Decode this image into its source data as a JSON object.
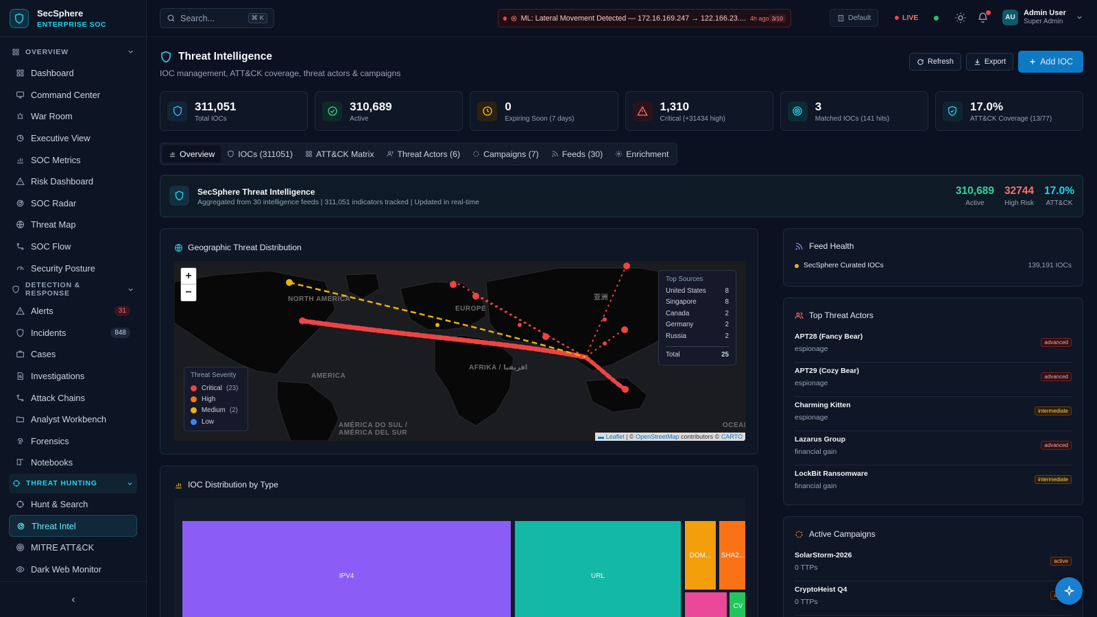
{
  "brand": {
    "name": "SecSphere",
    "subtitle": "ENTERPRISE SOC"
  },
  "sidebar": {
    "sections": [
      {
        "label": "OVERVIEW",
        "items": [
          {
            "label": "Dashboard",
            "icon": "grid-icon"
          },
          {
            "label": "Command Center",
            "icon": "monitor-icon"
          },
          {
            "label": "War Room",
            "icon": "siren-icon"
          },
          {
            "label": "Executive View",
            "icon": "pie-icon"
          },
          {
            "label": "SOC Metrics",
            "icon": "bar-chart-icon"
          },
          {
            "label": "Risk Dashboard",
            "icon": "warning-icon"
          },
          {
            "label": "SOC Radar",
            "icon": "radar-icon"
          },
          {
            "label": "Threat Map",
            "icon": "globe-icon"
          },
          {
            "label": "SOC Flow",
            "icon": "flow-icon"
          },
          {
            "label": "Security Posture",
            "icon": "gauge-icon"
          }
        ]
      },
      {
        "label": "DETECTION & RESPONSE",
        "items": [
          {
            "label": "Alerts",
            "icon": "warning-icon",
            "badge": "31"
          },
          {
            "label": "Incidents",
            "icon": "shield-icon",
            "badge": "848"
          },
          {
            "label": "Cases",
            "icon": "briefcase-icon"
          },
          {
            "label": "Investigations",
            "icon": "file-search-icon"
          },
          {
            "label": "Attack Chains",
            "icon": "flow-icon"
          },
          {
            "label": "Analyst Workbench",
            "icon": "folder-icon"
          },
          {
            "label": "Forensics",
            "icon": "fingerprint-icon"
          },
          {
            "label": "Notebooks",
            "icon": "book-icon"
          }
        ]
      },
      {
        "label": "THREAT HUNTING",
        "items": [
          {
            "label": "Hunt & Search",
            "icon": "crosshair-icon"
          },
          {
            "label": "Threat Intel",
            "icon": "radar-icon"
          },
          {
            "label": "MITRE ATT&CK",
            "icon": "target-icon"
          },
          {
            "label": "Dark Web Monitor",
            "icon": "eye-icon"
          }
        ]
      }
    ]
  },
  "topbar": {
    "search_placeholder": "Search...",
    "search_shortcut": "⌘ K",
    "alert_text": "ML: Lateral Movement Detected — 172.16.169.247 → 122.166.23....",
    "alert_ago": "4h ago",
    "alert_count": "3/10",
    "environment": "Default",
    "live_label": "LIVE",
    "user_initials": "AU",
    "user_name": "Admin User",
    "user_role": "Super Admin"
  },
  "page": {
    "title": "Threat Intelligence",
    "subtitle": "IOC management, ATT&CK coverage, threat actors & campaigns",
    "refresh_label": "Refresh",
    "export_label": "Export",
    "add_label": "Add IOC"
  },
  "stats": [
    {
      "value": "311,051",
      "label": "Total IOCs",
      "icon": "shield-icon",
      "color": "#38bdf8",
      "bg": "#102537"
    },
    {
      "value": "310,689",
      "label": "Active",
      "icon": "check-circle-icon",
      "color": "#34d399",
      "bg": "#0f2a25"
    },
    {
      "value": "0",
      "label": "Expiring Soon (7 days)",
      "icon": "clock-icon",
      "color": "#fbbf24",
      "bg": "#2a2210"
    },
    {
      "value": "1,310",
      "label": "Critical (+31434 high)",
      "icon": "warning-icon",
      "color": "#f87171",
      "bg": "#2a1318"
    },
    {
      "value": "3",
      "label": "Matched IOCs (141 hits)",
      "icon": "target-icon",
      "color": "#22d3ee",
      "bg": "#0f2a33"
    },
    {
      "value": "17.0%",
      "label": "ATT&CK Coverage (13/77)",
      "icon": "shield-check-icon",
      "color": "#22d3ee",
      "bg": "#112433"
    }
  ],
  "tabs": [
    {
      "label": "Overview",
      "icon": "bar-chart-icon",
      "active": true
    },
    {
      "label": "IOCs (311051)",
      "icon": "shield-icon"
    },
    {
      "label": "ATT&CK Matrix",
      "icon": "grid-icon"
    },
    {
      "label": "Threat Actors (6)",
      "icon": "users-icon"
    },
    {
      "label": "Campaigns (7)",
      "icon": "refresh-icon"
    },
    {
      "label": "Feeds (30)",
      "icon": "rss-icon"
    },
    {
      "label": "Enrichment",
      "icon": "gear-icon"
    }
  ],
  "banner": {
    "title": "SecSphere Threat Intelligence",
    "subtitle": "Aggregated from 30 intelligence feeds | 311,051 indicators tracked | Updated in real-time",
    "stats": [
      {
        "value": "310,689",
        "label": "Active",
        "color": "#34d399"
      },
      {
        "value": "32744",
        "label": "High Risk",
        "color": "#f87171"
      },
      {
        "value": "17.0%",
        "label": "ATT&CK",
        "color": "#22d3ee"
      }
    ]
  },
  "geo": {
    "title": "Geographic Threat Distribution",
    "map_labels": [
      "NORTH AMERICA",
      "EUROPE",
      "AFRIKA / افريقيا",
      "AMERICA",
      "AMÉRICA DO SUL / AMÉRICA DEL SUR",
      "亚洲",
      "OCEAN"
    ],
    "top_sources_title": "Top Sources",
    "top_sources": [
      {
        "name": "United States",
        "count": "8"
      },
      {
        "name": "Singapore",
        "count": "8"
      },
      {
        "name": "Canada",
        "count": "2"
      },
      {
        "name": "Germany",
        "count": "2"
      },
      {
        "name": "Russia",
        "count": "2"
      }
    ],
    "total_label": "Total",
    "total_value": "25",
    "legend_title": "Threat Severity",
    "legend": [
      {
        "label": "Critical",
        "count": "(23)",
        "color": "#ef4444"
      },
      {
        "label": "High",
        "count": "",
        "color": "#f97316"
      },
      {
        "label": "Medium",
        "count": "(2)",
        "color": "#eab308"
      },
      {
        "label": "Low",
        "count": "",
        "color": "#3b82f6"
      }
    ],
    "attrib_leaflet": "Leaflet",
    "attrib_osm": "OpenStreetMap",
    "attrib_contrib": "contributors ©",
    "attrib_carto": "CARTO"
  },
  "ioc_dist": {
    "title": "IOC Distribution by Type",
    "cells": [
      {
        "label": "IPV4",
        "color": "#8b5cf6"
      },
      {
        "label": "URL",
        "color": "#14b8a6"
      },
      {
        "label": "DOM...",
        "color": "#f59e0b"
      },
      {
        "label": "SHA2...",
        "color": "#f97316"
      },
      {
        "label": "",
        "color": "#ec4899"
      },
      {
        "label": "CV",
        "color": "#22c55e"
      }
    ]
  },
  "feed_health": {
    "title": "Feed Health",
    "feeds": [
      {
        "name": "SecSphere Curated IOCs",
        "count": "139,191 IOCs",
        "color": "#eab308"
      }
    ]
  },
  "actors": {
    "title": "Top Threat Actors",
    "items": [
      {
        "name": "APT28 (Fancy Bear)",
        "motive": "espionage",
        "level": "advanced"
      },
      {
        "name": "APT29 (Cozy Bear)",
        "motive": "espionage",
        "level": "advanced"
      },
      {
        "name": "Charming Kitten",
        "motive": "espionage",
        "level": "intermediate"
      },
      {
        "name": "Lazarus Group",
        "motive": "financial gain",
        "level": "advanced"
      },
      {
        "name": "LockBit Ransomware",
        "motive": "financial gain",
        "level": "intermediate"
      }
    ]
  },
  "campaigns": {
    "title": "Active Campaigns",
    "items": [
      {
        "name": "SolarStorm-2026",
        "ttps": "0 TTPs",
        "status": "active"
      },
      {
        "name": "CryptoHeist Q4",
        "ttps": "0 TTPs",
        "status": "active"
      }
    ]
  }
}
